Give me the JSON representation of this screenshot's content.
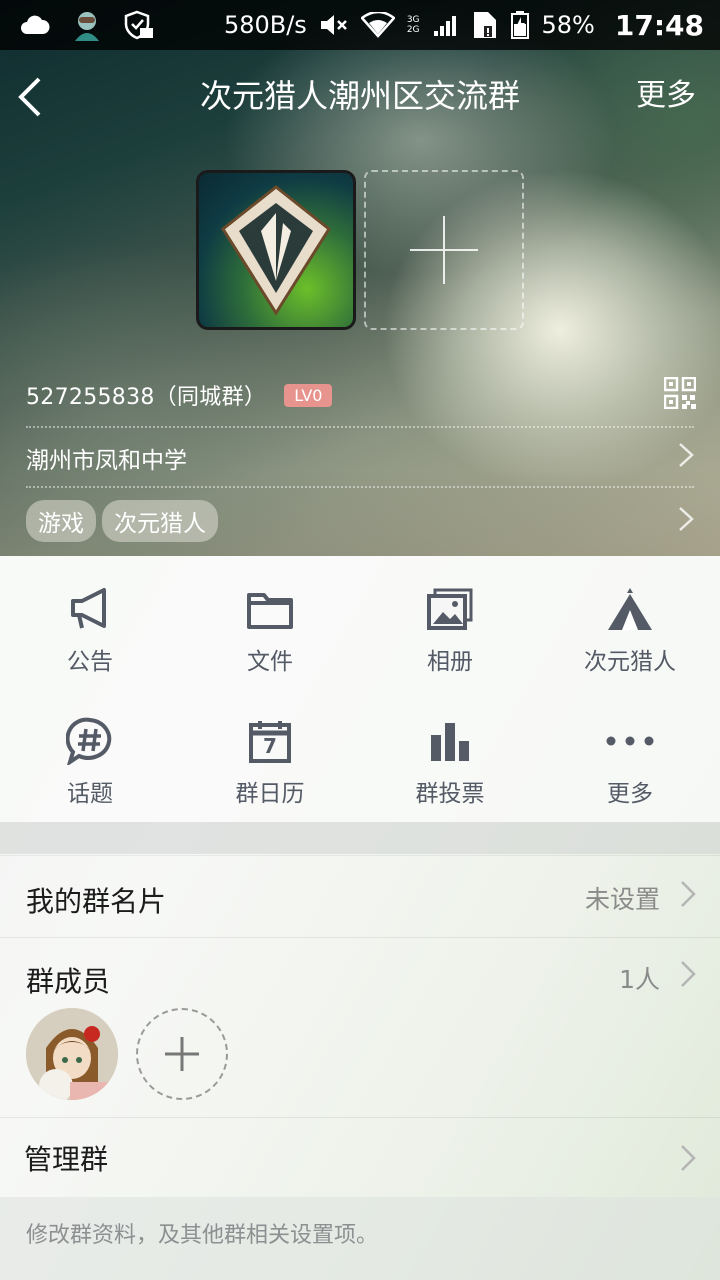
{
  "status_bar": {
    "speed": "580B/s",
    "net_top": "3G",
    "net_bottom": "2G",
    "battery": "58%",
    "time": "17:48"
  },
  "header": {
    "title": "次元猎人潮州区交流群",
    "more_label": "更多"
  },
  "group": {
    "id": "527255838（同城群）",
    "level": "LV0",
    "location": "潮州市凤和中学",
    "tags": [
      "游戏",
      "次元猎人"
    ]
  },
  "features": [
    {
      "label": "公告",
      "icon": "megaphone-icon"
    },
    {
      "label": "文件",
      "icon": "folder-icon"
    },
    {
      "label": "相册",
      "icon": "album-icon"
    },
    {
      "label": "次元猎人",
      "icon": "tent-icon"
    },
    {
      "label": "话题",
      "icon": "topic-hash-icon"
    },
    {
      "label": "群日历",
      "icon": "calendar-icon"
    },
    {
      "label": "群投票",
      "icon": "vote-bar-icon"
    },
    {
      "label": "更多",
      "icon": "more-dots-icon"
    }
  ],
  "calendar_day": "7",
  "list": {
    "card_label": "我的群名片",
    "card_value": "未设置",
    "members_label": "群成员",
    "members_count": "1人",
    "admin_label": "管理群",
    "admin_note": "修改群资料，及其他群相关设置项。"
  },
  "colors": {
    "accent_badge": "#e6948d",
    "icon_gray": "#555b66"
  }
}
